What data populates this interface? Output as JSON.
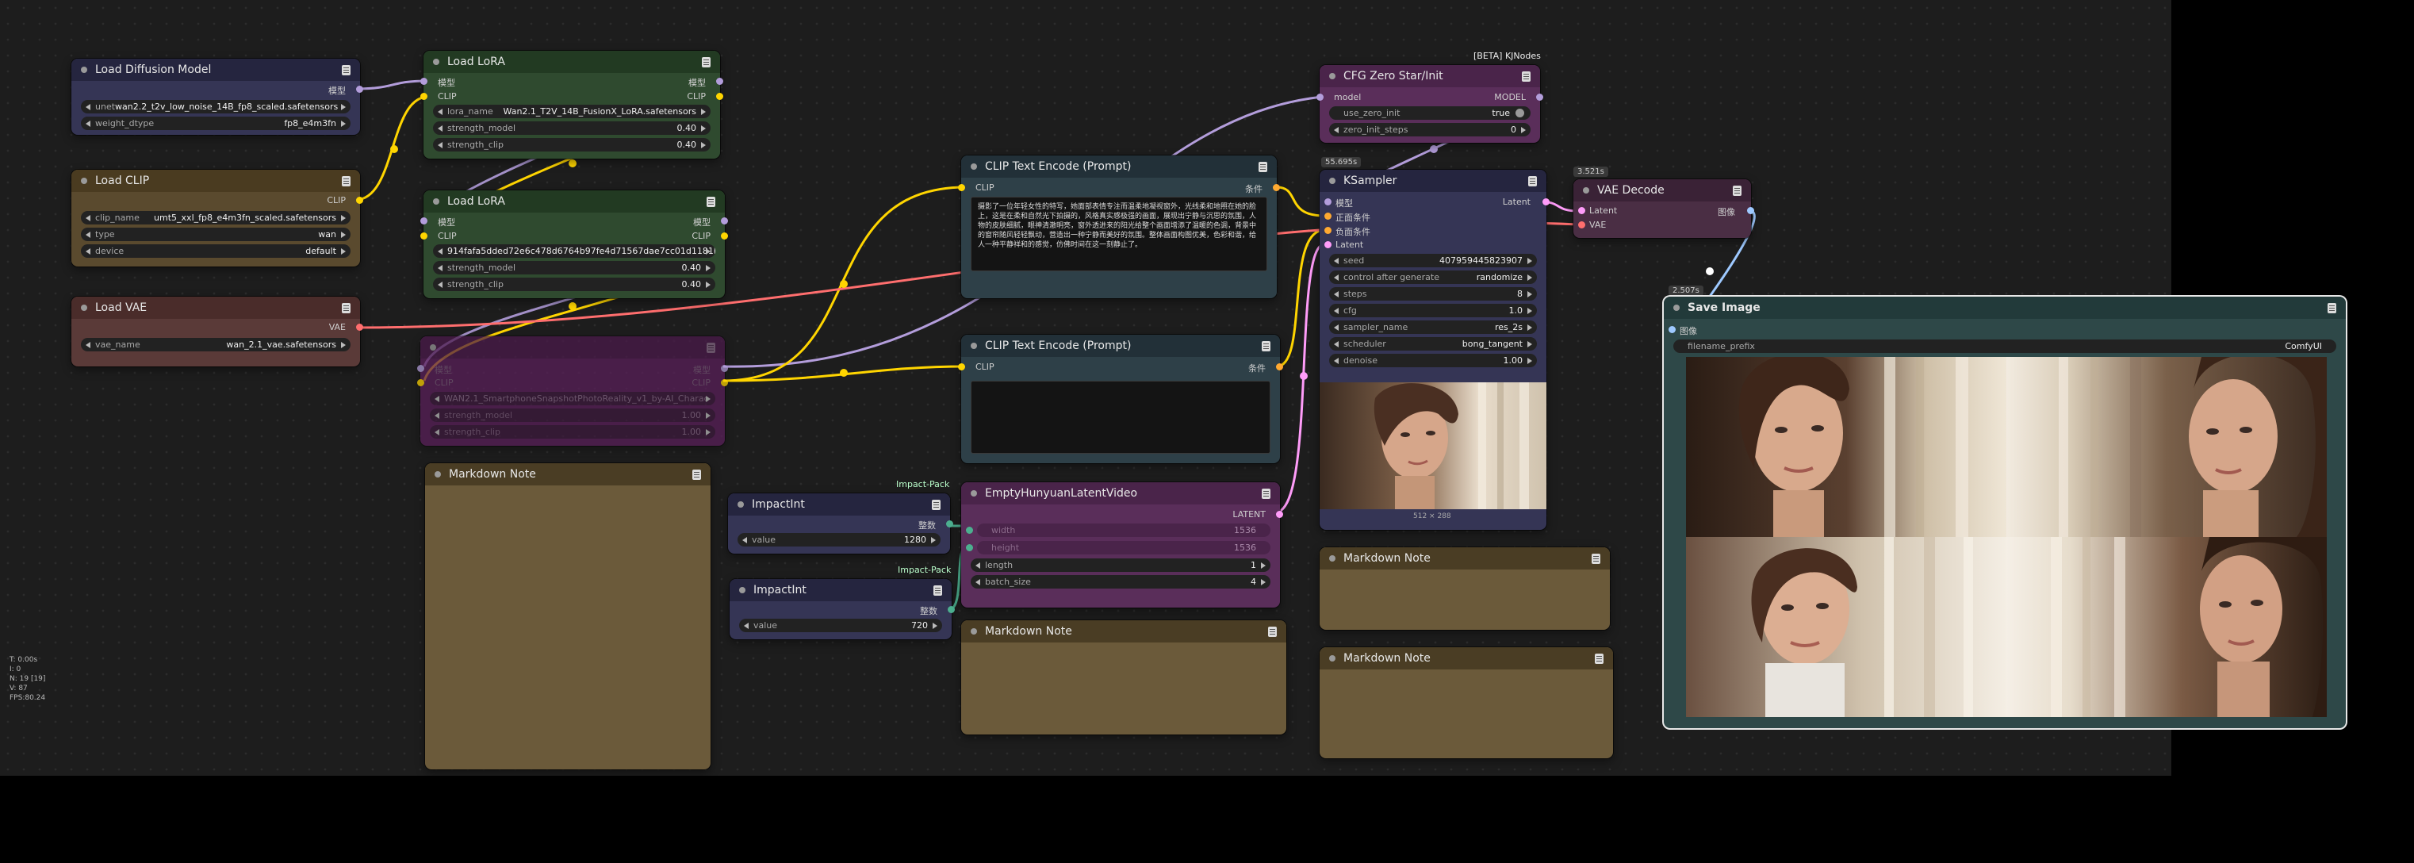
{
  "colors": {
    "clip_wire": "#ffd500",
    "model_wire": "#b39ddb",
    "vae_wire": "#ff6e6e",
    "latent_wire": "#ff9cf9"
  },
  "nodes": {
    "load_diffusion": {
      "title": "Load Diffusion Model",
      "out": "模型",
      "w1_label": "unet",
      "w1_value": "wan2.2_t2v_low_noise_14B_fp8_scaled.safetensors",
      "w2_label": "weight_dtype",
      "w2_value": "fp8_e4m3fn"
    },
    "load_clip": {
      "title": "Load CLIP",
      "out": "CLIP",
      "w1_label": "clip_name",
      "w1_value": "umt5_xxl_fp8_e4m3fn_scaled.safetensors",
      "w2_label": "type",
      "w2_value": "wan",
      "w3_label": "device",
      "w3_value": "default"
    },
    "load_vae": {
      "title": "Load VAE",
      "out": "VAE",
      "w1_label": "vae_name",
      "w1_value": "wan_2.1_vae.safetensors"
    },
    "lora1": {
      "title": "Load LoRA",
      "in1": "模型",
      "in2": "CLIP",
      "out1": "模型",
      "out2": "CLIP",
      "w1_label": "lora_name",
      "w1_value": "Wan2.1_T2V_14B_FusionX_LoRA.safetensors",
      "w2_label": "strength_model",
      "w2_value": "0.40",
      "w3_label": "strength_clip",
      "w3_value": "0.40"
    },
    "lora2": {
      "title": "Load LoRA",
      "in1": "模型",
      "in2": "CLIP",
      "out1": "模型",
      "out2": "CLIP",
      "w1_label": "",
      "w1_value": "914fafa5dded72e6c478d6764b97fe4d71567dae7cc01d1181b",
      "w2_label": "strength_model",
      "w2_value": "0.40",
      "w3_label": "strength_clip",
      "w3_value": "0.40"
    },
    "lora3": {
      "in1": "模型",
      "in2": "CLIP",
      "out1": "模型",
      "out2": "CLIP",
      "w1_value": "WAN2.1_SmartphoneSnapshotPhotoReality_v1_by-AI_Charac",
      "w2_label": "strength_model",
      "w2_value": "1.00",
      "w3_label": "strength_clip",
      "w3_value": "1.00"
    },
    "md1": {
      "title": "Markdown Note"
    },
    "md2": {
      "title": "Markdown Note"
    },
    "md3": {
      "title": "Markdown Note"
    },
    "md4": {
      "title": "Markdown Note"
    },
    "int1": {
      "title": "ImpactInt",
      "tag": "Impact-Pack",
      "out": "整数",
      "w_label": "value",
      "w_value": "1280"
    },
    "int2": {
      "title": "ImpactInt",
      "tag": "Impact-Pack",
      "out": "整数",
      "w_label": "value",
      "w_value": "720"
    },
    "clip_pos": {
      "title": "CLIP Text Encode (Prompt)",
      "in": "CLIP",
      "out": "条件",
      "text": "摄影了一位年轻女性的特写，她面部表情专注而温柔地凝视窗外，光线柔和地照在她的脸上，这是在柔和自然光下拍摄的，风格真实感极强的画面，展现出宁静与沉思的氛围，人物的皮肤细腻，眼神清澈明亮，窗外透进来的阳光给整个画面增添了温暖的色调，背景中的窗帘随风轻轻飘动，营造出一种宁静而美好的氛围。整体画面构图优美，色彩和谐，给人一种平静祥和的感觉，仿佛时间在这一刻静止了。"
    },
    "clip_neg": {
      "title": "CLIP Text Encode (Prompt)",
      "in": "CLIP",
      "out": "条件"
    },
    "empty_latent": {
      "title": "EmptyHunyuanLatentVideo",
      "out": "LATENT",
      "w1_label": "width",
      "w1_value": "1536",
      "w2_label": "height",
      "w2_value": "1536",
      "w3_label": "length",
      "w3_value": "1",
      "w4_label": "batch_size",
      "w4_value": "4"
    },
    "cfg_zero": {
      "title": "CFG Zero Star/Init",
      "tag": "[BETA] KJNodes",
      "in": "model",
      "out": "MODEL",
      "w1_label": "use_zero_init",
      "w1_value": "true",
      "w2_label": "zero_init_steps",
      "w2_value": "0"
    },
    "ksampler": {
      "title": "KSampler",
      "time": "55.695s",
      "in1": "模型",
      "in2": "正面条件",
      "in3": "负面条件",
      "in4": "Latent",
      "out": "Latent",
      "seed_label": "seed",
      "seed": "407959445823907",
      "cag_label": "control after generate",
      "cag": "randomize",
      "steps_label": "steps",
      "steps": "8",
      "cfg_label": "cfg",
      "cfg": "1.0",
      "sampler_label": "sampler_name",
      "sampler": "res_2s",
      "scheduler_label": "scheduler",
      "scheduler": "bong_tangent",
      "denoise_label": "denoise",
      "denoise": "1.00",
      "preview_caption": "512 × 288"
    },
    "vae_decode": {
      "title": "VAE Decode",
      "time": "3.521s",
      "in1": "Latent",
      "in2": "VAE",
      "out": "图像"
    },
    "save_image": {
      "title": "Save Image",
      "time": "2.507s",
      "in": "图像",
      "w_label": "filename_prefix",
      "w_value": "ComfyUI"
    }
  },
  "stats": [
    "T: 0.00s",
    "I: 0",
    "N: 19 [19]",
    "V: 87",
    "FPS:80.24"
  ]
}
